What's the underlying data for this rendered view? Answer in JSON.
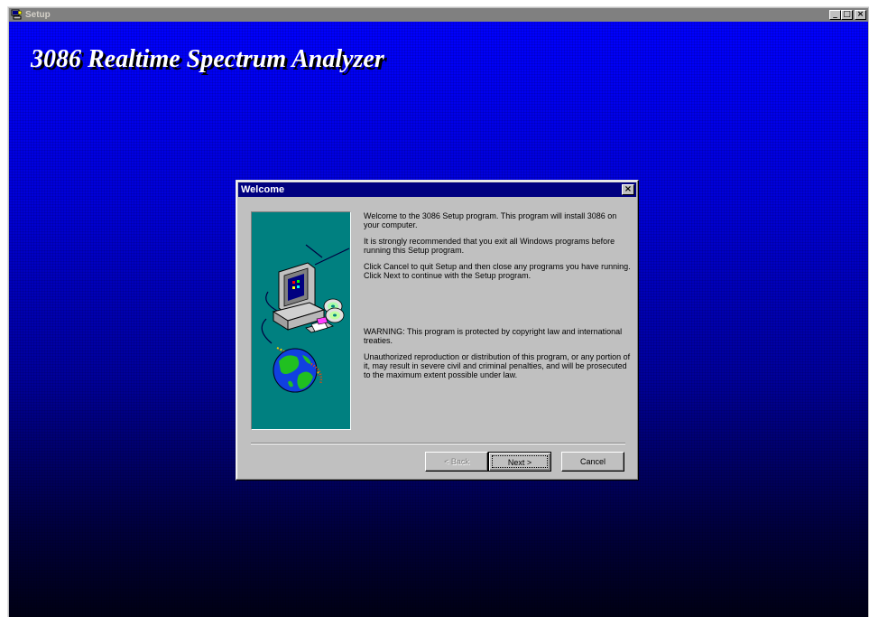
{
  "window": {
    "title": "Setup",
    "controls": {
      "minimize": "_",
      "maximize": "□",
      "close": "×"
    }
  },
  "banner": {
    "title": "3086 Realtime Spectrum Analyzer"
  },
  "dialog": {
    "title": "Welcome",
    "close": "×",
    "paragraphs": [
      "Welcome to the 3086 Setup program.  This program will install 3086 on your computer.",
      "It is strongly recommended that you exit all Windows programs before running this Setup program.",
      "Click Cancel to quit Setup and then close any programs you have running.  Click Next to continue with the Setup program.",
      "WARNING: This program is protected by copyright law and international treaties.",
      "Unauthorized reproduction or distribution of this program, or any portion of it, may result in severe civil and criminal penalties, and will be prosecuted to the maximum extent possible under law."
    ],
    "buttons": {
      "back": "< Back",
      "next": "Next >",
      "cancel": "Cancel"
    }
  },
  "colors": {
    "dialog_title_bg": "#000080",
    "art_bg": "#008080",
    "stage_top": "#0000ff",
    "stage_bottom": "#000014"
  },
  "icons": [
    "setup-app-icon",
    "computer-icon",
    "cd-disc-icon",
    "floppy-disk-icon",
    "globe-icon"
  ]
}
